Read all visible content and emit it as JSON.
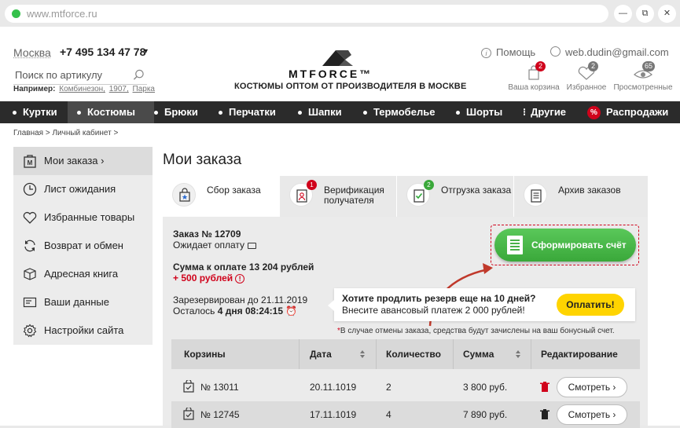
{
  "browser": {
    "url": "www.mtforce.ru"
  },
  "header": {
    "city": "Москва",
    "phone": "+7 495 134 47 78",
    "search_placeholder": "Поиск по артикулу",
    "example_label": "Например:",
    "example_items": [
      "Комбинезон,",
      "1907,",
      "Парка"
    ],
    "logo_text": "MTFORCE™",
    "tagline": "КОСТЮМЫ ОПТОМ ОТ ПРОИЗВОДИТЕЛЯ В МОСКВЕ",
    "help": "Помощь",
    "user_email": "web.dudin@gmail.com",
    "cart": {
      "label": "Ваша корзина",
      "count": "2"
    },
    "favorites": {
      "label": "Избранное",
      "count": "2"
    },
    "viewed": {
      "label": "Просмотренные",
      "count": "65"
    }
  },
  "nav": [
    {
      "label": "Куртки"
    },
    {
      "label": "Костюмы"
    },
    {
      "label": "Брюки"
    },
    {
      "label": "Перчатки"
    },
    {
      "label": "Шапки"
    },
    {
      "label": "Термобелье"
    },
    {
      "label": "Шорты"
    },
    {
      "label": "Другие"
    },
    {
      "label": "Распродажи"
    }
  ],
  "breadcrumb": {
    "home": "Главная",
    "sep": ">",
    "current": "Личный кабинет",
    "sep2": ">"
  },
  "sidebar": [
    {
      "label": "Мои заказа ›",
      "icon": "orders-icon"
    },
    {
      "label": "Лист ожидания",
      "icon": "clock-icon"
    },
    {
      "label": "Избранные товары",
      "icon": "heart-icon"
    },
    {
      "label": "Возврат и обмен",
      "icon": "refresh-icon"
    },
    {
      "label": "Адресная книга",
      "icon": "box-icon"
    },
    {
      "label": "Ваши данные",
      "icon": "id-card-icon"
    },
    {
      "label": "Настройки сайта",
      "icon": "gear-icon"
    }
  ],
  "main": {
    "title": "Мои заказа",
    "tabs": [
      {
        "label": "Сбор заказа",
        "badge": ""
      },
      {
        "label": "Верификация получателя",
        "badge": "1"
      },
      {
        "label": "Отгрузка заказа",
        "badge": "2"
      },
      {
        "label": "Архив заказов",
        "badge": ""
      }
    ],
    "order": {
      "number": "Заказ № 12709",
      "status": "Ожидает оплату",
      "sum": "Сумма к оплате 13 204 рублей",
      "extra": "+ 500 рублей",
      "reserved": "Зарезервирован до 21.11.2019",
      "remain_label": "Осталось",
      "remain_value": "4 дня 08:24:15"
    },
    "form_button": "Сформировать счёт",
    "promo": {
      "question": "Хотите продлить резерв еще на 10 дней?",
      "sub": "Внесите авансовый платеж 2 000 рублей!",
      "pay_button": "Оплатить!"
    },
    "note": "В случае отмены заказа, средства будут зачислены на ваш бонусный счет.",
    "table": {
      "headers": [
        "Корзины",
        "Дата",
        "Количество",
        "Сумма",
        "Редактирование"
      ],
      "rows": [
        {
          "cart": "№ 13011",
          "date": "20.11.1019",
          "qty": "2",
          "sum": "3 800 руб.",
          "action": "Смотреть ›"
        },
        {
          "cart": "№ 12745",
          "date": "17.11.1019",
          "qty": "4",
          "sum": "7 890 руб.",
          "action": "Смотреть ›"
        }
      ]
    }
  },
  "colors": {
    "green": "#3aa83a",
    "red": "#d0021b",
    "yellow": "#ffd400",
    "nav_bg": "#2b2b2b"
  }
}
